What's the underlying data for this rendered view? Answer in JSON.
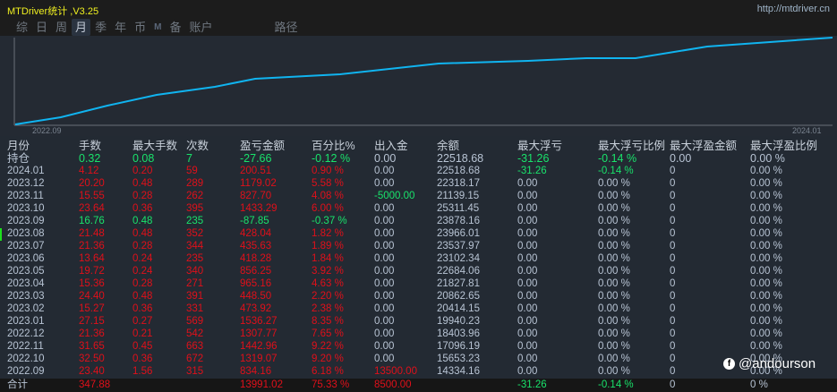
{
  "app": {
    "title": "MTDriver统计 ,V3.25",
    "url": "http://mtdriver.cn"
  },
  "tabs": [
    "综",
    "日",
    "周",
    "月",
    "季",
    "年",
    "币",
    "M",
    "备",
    "账户",
    "路径"
  ],
  "active_tab": "月",
  "chart": {
    "x_start": "2022.09",
    "x_end": "2024.01",
    "line_color": "#10b4f0"
  },
  "columns": [
    "月份",
    "手数",
    "最大手数",
    "次数",
    "盈亏金额",
    "百分比%",
    "出入金",
    "余额",
    "最大浮亏",
    "最大浮亏比例",
    "最大浮盈金额",
    "最大浮盈比例"
  ],
  "rows": [
    [
      "持仓",
      "0.32",
      "0.08",
      "7",
      "-27.66",
      "-0.12 %",
      "0.00",
      "22518.68",
      "-31.26",
      "-0.14 %",
      "0.00",
      "0.00 %"
    ],
    [
      "2024.01",
      "4.12",
      "0.20",
      "59",
      "200.51",
      "0.90 %",
      "0.00",
      "22518.68",
      "-31.26",
      "-0.14 %",
      "0",
      "0.00 %"
    ],
    [
      "2023.12",
      "20.20",
      "0.48",
      "289",
      "1179.02",
      "5.58 %",
      "0.00",
      "22318.17",
      "0.00",
      "0.00 %",
      "0",
      "0.00 %"
    ],
    [
      "2023.11",
      "15.55",
      "0.28",
      "262",
      "827.70",
      "4.08 %",
      "-5000.00",
      "21139.15",
      "0.00",
      "0.00 %",
      "0",
      "0.00 %"
    ],
    [
      "2023.10",
      "23.64",
      "0.36",
      "395",
      "1433.29",
      "6.00 %",
      "0.00",
      "25311.45",
      "0.00",
      "0.00 %",
      "0",
      "0.00 %"
    ],
    [
      "2023.09",
      "16.76",
      "0.48",
      "235",
      "-87.85",
      "-0.37 %",
      "0.00",
      "23878.16",
      "0.00",
      "0.00 %",
      "0",
      "0.00 %"
    ],
    [
      "2023.08",
      "21.48",
      "0.48",
      "352",
      "428.04",
      "1.82 %",
      "0.00",
      "23966.01",
      "0.00",
      "0.00 %",
      "0",
      "0.00 %"
    ],
    [
      "2023.07",
      "21.36",
      "0.28",
      "344",
      "435.63",
      "1.89 %",
      "0.00",
      "23537.97",
      "0.00",
      "0.00 %",
      "0",
      "0.00 %"
    ],
    [
      "2023.06",
      "13.64",
      "0.24",
      "235",
      "418.28",
      "1.84 %",
      "0.00",
      "23102.34",
      "0.00",
      "0.00 %",
      "0",
      "0.00 %"
    ],
    [
      "2023.05",
      "19.72",
      "0.24",
      "340",
      "856.25",
      "3.92 %",
      "0.00",
      "22684.06",
      "0.00",
      "0.00 %",
      "0",
      "0.00 %"
    ],
    [
      "2023.04",
      "15.36",
      "0.28",
      "271",
      "965.16",
      "4.63 %",
      "0.00",
      "21827.81",
      "0.00",
      "0.00 %",
      "0",
      "0.00 %"
    ],
    [
      "2023.03",
      "24.40",
      "0.48",
      "391",
      "448.50",
      "2.20 %",
      "0.00",
      "20862.65",
      "0.00",
      "0.00 %",
      "0",
      "0.00 %"
    ],
    [
      "2023.02",
      "15.27",
      "0.36",
      "331",
      "473.92",
      "2.38 %",
      "0.00",
      "20414.15",
      "0.00",
      "0.00 %",
      "0",
      "0.00 %"
    ],
    [
      "2023.01",
      "27.15",
      "0.27",
      "569",
      "1536.27",
      "8.35 %",
      "0.00",
      "19940.23",
      "0.00",
      "0.00 %",
      "0",
      "0.00 %"
    ],
    [
      "2022.12",
      "21.36",
      "0.21",
      "542",
      "1307.77",
      "7.65 %",
      "0.00",
      "18403.96",
      "0.00",
      "0.00 %",
      "0",
      "0.00 %"
    ],
    [
      "2022.11",
      "31.65",
      "0.45",
      "663",
      "1442.96",
      "9.22 %",
      "0.00",
      "17096.19",
      "0.00",
      "0.00 %",
      "0",
      "0.00 %"
    ],
    [
      "2022.10",
      "32.50",
      "0.36",
      "672",
      "1319.07",
      "9.20 %",
      "0.00",
      "15653.23",
      "0.00",
      "0.00 %",
      "0",
      "0.00 %"
    ],
    [
      "2022.09",
      "23.40",
      "1.56",
      "315",
      "834.16",
      "6.18 %",
      "13500.00",
      "14334.16",
      "0.00",
      "0.00 %",
      "0",
      "0.00 %"
    ]
  ],
  "total": [
    "合计",
    "347.88",
    "",
    "",
    "13991.02",
    "75.33 %",
    "8500.00",
    "",
    "-31.26",
    "-0.14 %",
    "0",
    "0 %"
  ],
  "watermark": "@andourson",
  "colors": {
    "profit": "#e0101a",
    "loss": "#19e36b",
    "neutral": "#b8c4d4"
  }
}
